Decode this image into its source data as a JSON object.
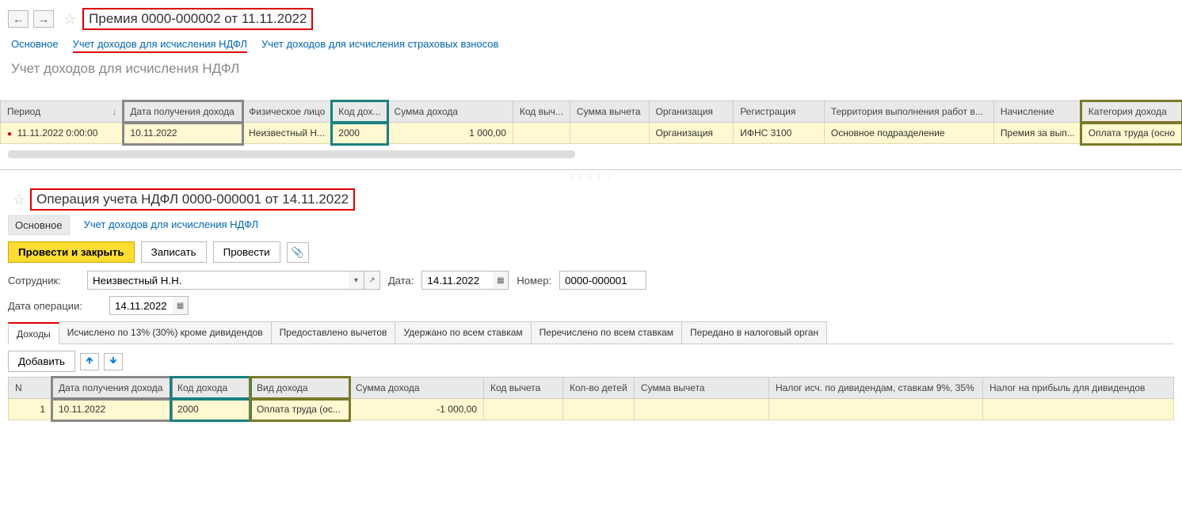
{
  "top": {
    "title": "Премия 0000-000002 от 11.11.2022",
    "tabs": {
      "main": "Основное",
      "ndfl": "Учет доходов для исчисления НДФЛ",
      "insurance": "Учет доходов для исчисления страховых взносов"
    },
    "sectionTitle": "Учет доходов для исчисления НДФЛ",
    "headers": {
      "period": "Период",
      "incomeDate": "Дата получения дохода",
      "person": "Физическое лицо",
      "incomeCode": "Код дох...",
      "incomeSum": "Сумма дохода",
      "deductCode": "Код выч...",
      "deductSum": "Сумма вычета",
      "org": "Организация",
      "reg": "Регистрация",
      "territory": "Территория выполнения работ в...",
      "accrual": "Начисление",
      "category": "Категория дохода"
    },
    "row": {
      "period": "11.11.2022 0:00:00",
      "incomeDate": "10.11.2022",
      "person": "Неизвестный Н...",
      "incomeCode": "2000",
      "incomeSum": "1 000,00",
      "deductCode": "",
      "deductSum": "",
      "org": "Организация",
      "reg": "ИФНС 3100",
      "territory": "Основное подразделение",
      "accrual": "Премия за вып...",
      "category": "Оплата труда (осно"
    }
  },
  "bottom": {
    "title": "Операция учета НДФЛ 0000-000001 от 14.11.2022",
    "subTabs": {
      "main": "Основное",
      "ndfl": "Учет доходов для исчисления НДФЛ"
    },
    "buttons": {
      "postClose": "Провести и закрыть",
      "write": "Записать",
      "post": "Провести"
    },
    "form": {
      "employeeLabel": "Сотрудник:",
      "employee": "Неизвестный Н.Н.",
      "dateLabel": "Дата:",
      "date": "14.11.2022",
      "numberLabel": "Номер:",
      "number": "0000-000001",
      "opDateLabel": "Дата операции:",
      "opDate": "14.11.2022"
    },
    "innerTabs": {
      "income": "Доходы",
      "calc13": "Исчислено по 13% (30%) кроме дивидендов",
      "deducts": "Предоставлено вычетов",
      "withheld": "Удержано по всем ставкам",
      "transferred": "Перечислено по всем ставкам",
      "sentToTax": "Передано в налоговый орган"
    },
    "rowToolbar": {
      "add": "Добавить"
    },
    "headers": {
      "n": "N",
      "incomeDate": "Дата получения дохода",
      "incomeCode": "Код дохода",
      "incomeType": "Вид дохода",
      "incomeSum": "Сумма дохода",
      "deductCode": "Код вычета",
      "kids": "Кол-во детей",
      "deductSum": "Сумма вычета",
      "divTax": "Налог исч. по дивидендам, ставкам 9%, 35%",
      "profitTax": "Налог на прибыль для дивидендов"
    },
    "row": {
      "n": "1",
      "incomeDate": "10.11.2022",
      "incomeCode": "2000",
      "incomeType": "Оплата труда (ос...",
      "incomeSum": "-1 000,00"
    }
  }
}
